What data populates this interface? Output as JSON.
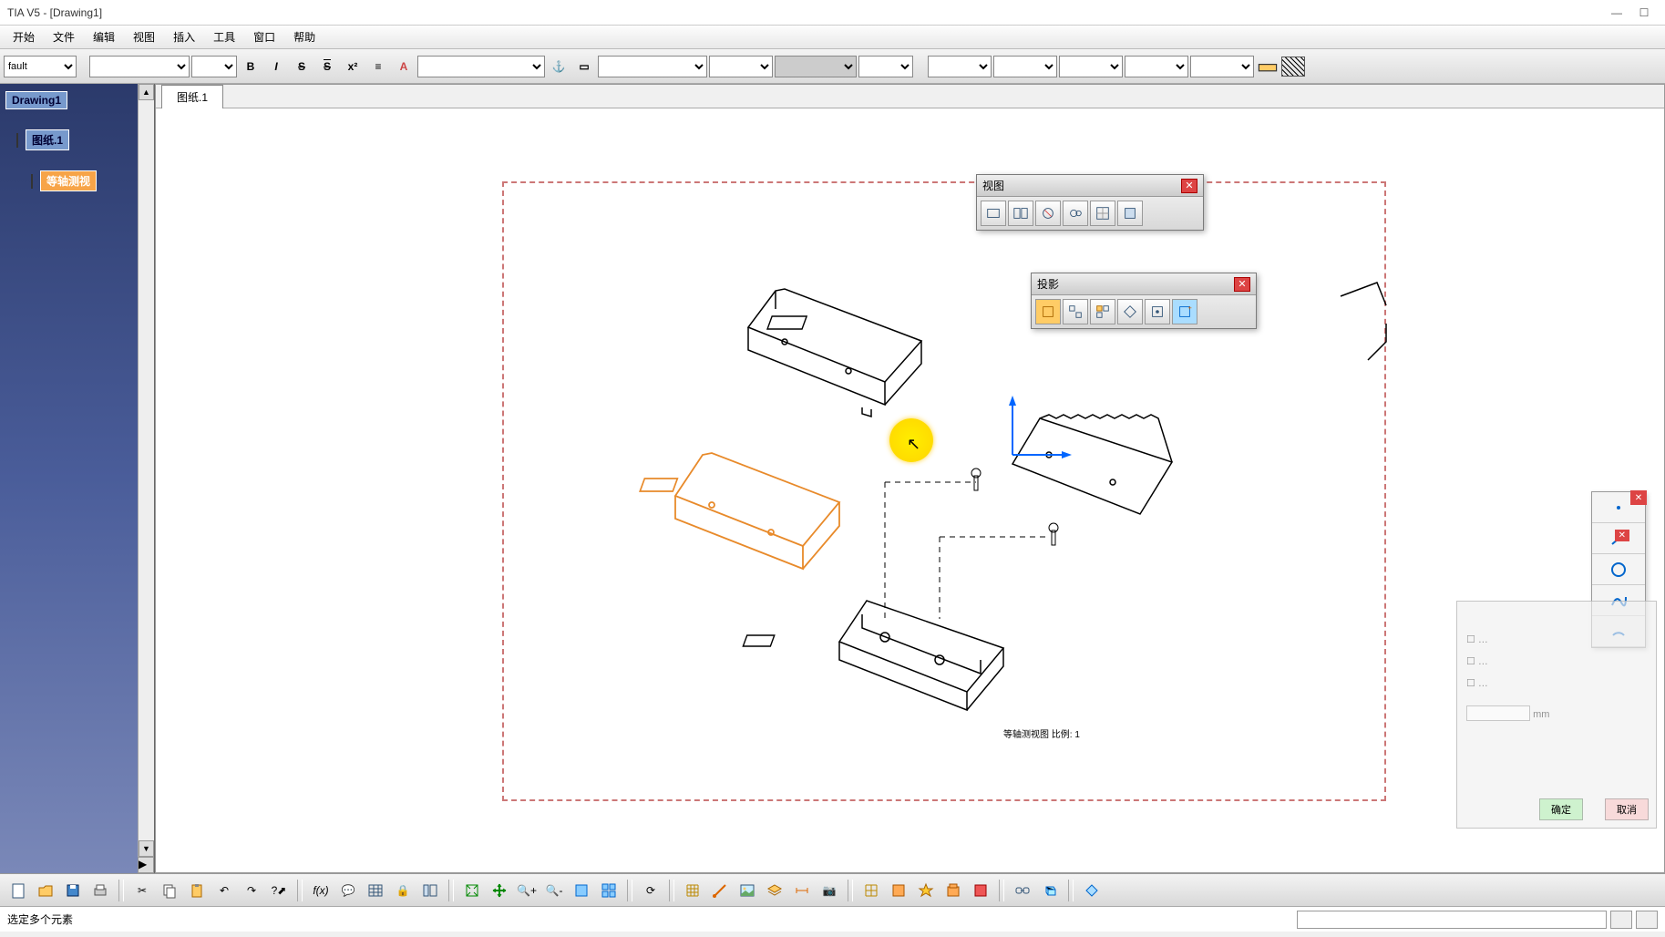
{
  "window": {
    "title": "TIA V5 - [Drawing1]"
  },
  "menu": [
    "开始",
    "文件",
    "编辑",
    "视图",
    "插入",
    "工具",
    "窗口",
    "帮助"
  ],
  "style_combo": "fault",
  "tree": {
    "root": "Drawing1",
    "sheet": "图纸.1",
    "view": "等轴测视"
  },
  "sheet_tab": "图纸.1",
  "float_view": {
    "title": "视图"
  },
  "float_proj": {
    "title": "投影"
  },
  "canvas_label": "等轴测视图\n比例: 1",
  "status": "选定多个元素",
  "faded": {
    "ok": "确定",
    "cancel": "取消",
    "mm": "mm"
  }
}
